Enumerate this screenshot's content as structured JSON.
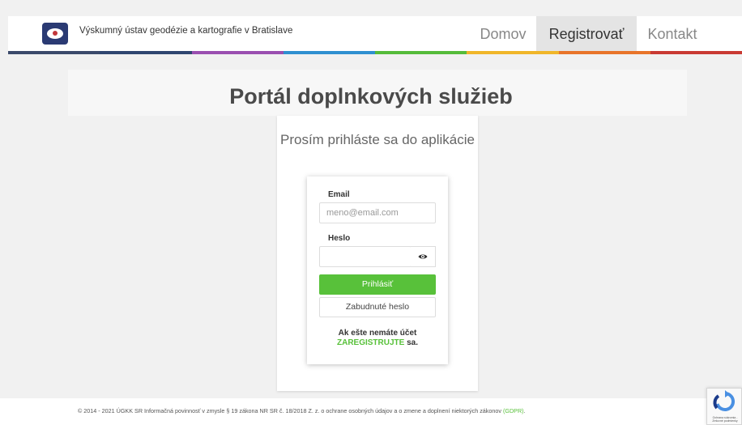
{
  "header": {
    "site_title": "Výskumný ústav geodézie a kartografie v Bratislave",
    "nav": {
      "home": "Domov",
      "register": "Registrovať",
      "contact": "Kontakt"
    }
  },
  "color_bar": [
    "#3b4a6b",
    "#2f4670",
    "#9a4fb0",
    "#2f8fd0",
    "#55bb3a",
    "#f0b62a",
    "#e8742a",
    "#c93a33"
  ],
  "page_title": "Portál doplnkových služieb",
  "login": {
    "title": "Prosím prihláste sa do aplikácie",
    "email_label": "Email",
    "email_placeholder": "meno@email.com",
    "password_label": "Heslo",
    "password_value": "",
    "login_button": "Prihlásiť",
    "forgot_button": "Zabudnuté heslo",
    "no_account": "Ak ešte nemáte účet",
    "register_link": "ZAREGISTRUJTE",
    "register_suffix": " sa."
  },
  "footer": {
    "text": "© 2014 - 2021 ÚGKK SR Informačná povinnosť v zmysle § 19 zákona NR SR č. 18/2018 Z. z. o ochrane osobných údajov a o zmene a doplnení niektorých zákonov ",
    "gdpr_link": "(GDPR)",
    "suffix": "."
  },
  "recaptcha": {
    "text": "Ochrana súkromia - Zmluvné podmienky"
  },
  "colors": {
    "accent_green": "#58c13a",
    "logo_blue": "#2a3a73"
  }
}
